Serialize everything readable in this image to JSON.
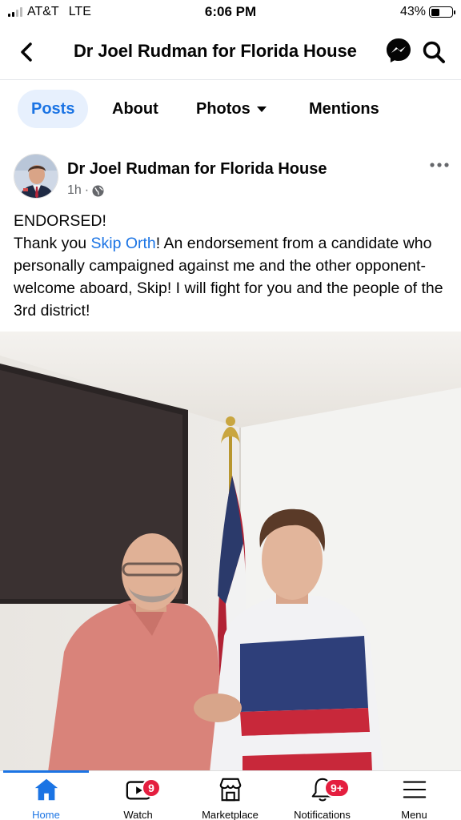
{
  "status_bar": {
    "carrier": "AT&T",
    "network": "LTE",
    "time": "6:06 PM",
    "battery_percent": "43%",
    "battery_level": 0.43
  },
  "header": {
    "title": "Dr Joel Rudman for Florida House",
    "icons": [
      "back-icon",
      "messenger-icon",
      "search-icon"
    ]
  },
  "tabs": [
    {
      "label": "Posts",
      "active": true
    },
    {
      "label": "About",
      "active": false
    },
    {
      "label": "Photos",
      "active": false
    },
    {
      "label": "Mentions",
      "active": false
    }
  ],
  "post": {
    "author": "Dr Joel Rudman for Florida House",
    "time": "1h",
    "separator": "·",
    "text_line1": "ENDORSED!",
    "text_prefix": "Thank you ",
    "text_link": "Skip Orth",
    "text_rest": "! An endorsement from a candidate who personally campaigned against me and the other opponent- welcome aboard, Skip! I will fight for you and the people of the  3rd district!",
    "link_color": "#1b74e4"
  },
  "bottom_nav": [
    {
      "label": "Home",
      "icon": "home-icon",
      "active": true,
      "badge": ""
    },
    {
      "label": "Watch",
      "icon": "watch-icon",
      "active": false,
      "badge": "9"
    },
    {
      "label": "Marketplace",
      "icon": "marketplace-icon",
      "active": false,
      "badge": ""
    },
    {
      "label": "Notifications",
      "icon": "bell-icon",
      "active": false,
      "badge": "9+"
    },
    {
      "label": "Menu",
      "icon": "menu-icon",
      "active": false,
      "badge": ""
    }
  ],
  "colors": {
    "accent": "#1b74e4",
    "badge": "#e41e3f",
    "tab_active_bg": "#e7f0fd"
  }
}
